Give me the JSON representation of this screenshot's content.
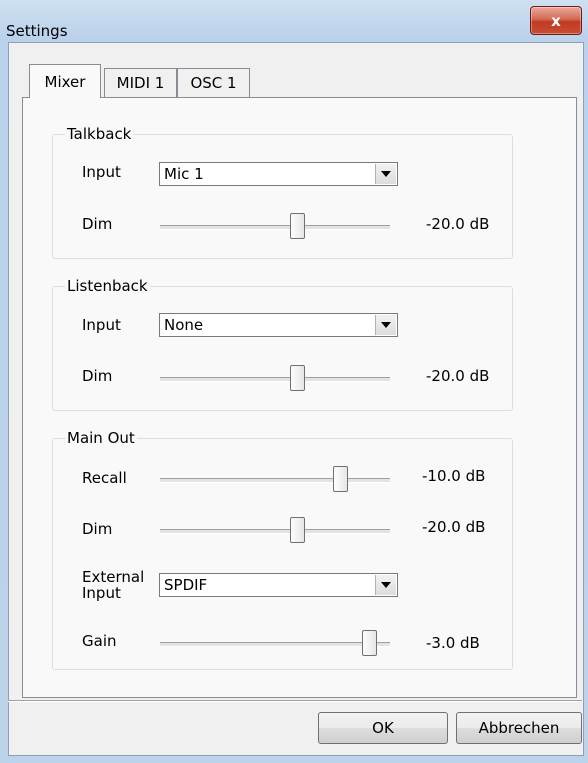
{
  "window": {
    "title": "Settings",
    "close_glyph": "x"
  },
  "tabs": [
    {
      "label": "Mixer",
      "selected": true
    },
    {
      "label": "MIDI 1",
      "selected": false
    },
    {
      "label": "OSC 1",
      "selected": false
    }
  ],
  "talkback": {
    "title": "Talkback",
    "input_label": "Input",
    "input_value": "Mic 1",
    "dim_label": "Dim",
    "dim_value": "-20.0 dB",
    "dim_level": 0.6
  },
  "listenback": {
    "title": "Listenback",
    "input_label": "Input",
    "input_value": "None",
    "dim_label": "Dim",
    "dim_value": "-20.0 dB",
    "dim_level": 0.6
  },
  "main_out": {
    "title": "Main Out",
    "recall_label": "Recall",
    "recall_value": "-10.0 dB",
    "recall_level": 0.8,
    "dim_label": "Dim",
    "dim_value": "-20.0 dB",
    "dim_level": 0.6,
    "external_input_label_1": "External",
    "external_input_label_2": "Input",
    "external_input_value": "SPDIF",
    "gain_label": "Gain",
    "gain_value": "-3.0 dB",
    "gain_level": 0.94
  },
  "buttons": {
    "ok": "OK",
    "cancel": "Abbrechen"
  },
  "icons": {
    "dropdown": "chevron-down-icon",
    "close": "close-icon"
  }
}
